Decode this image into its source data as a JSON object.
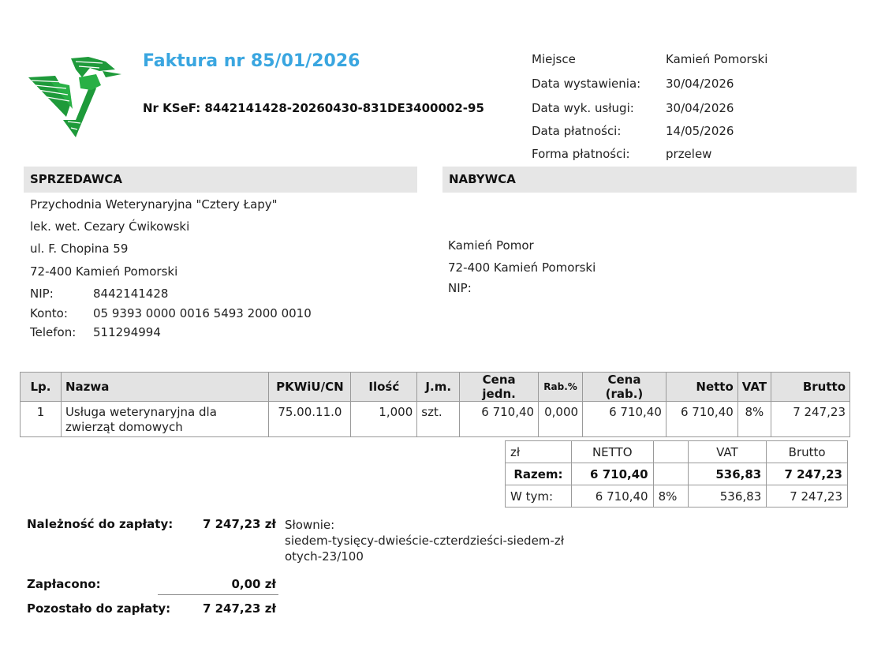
{
  "header": {
    "title": "Faktura nr 85/01/2026",
    "ksef": "Nr KSeF: 8442141428-20260430-831DE3400002-95"
  },
  "meta": [
    {
      "label": "Miejsce",
      "value": "Kamień Pomorski"
    },
    {
      "label": "Data wystawienia:",
      "value": "30/04/2026"
    },
    {
      "label": "Data wyk. usługi:",
      "value": "30/04/2026"
    },
    {
      "label": "Data płatności:",
      "value": "14/05/2026"
    },
    {
      "label": "Forma płatności:",
      "value": "przelew"
    }
  ],
  "seller": {
    "heading": "SPRZEDAWCA",
    "name": "Przychodnia Weterynaryjna \"Cztery Łapy\"",
    "person": "lek. wet. Cezary Ćwikowski",
    "street": "ul. F. Chopina 59",
    "city": "72-400 Kamień Pomorski",
    "nip_label": "NIP:",
    "nip": "8442141428",
    "account_label": "Konto:",
    "account": "05 9393 0000 0016 5493 2000 0010",
    "phone_label": "Telefon:",
    "phone": "511294994"
  },
  "buyer": {
    "heading": "NABYWCA",
    "line1": "Kamień Pomor",
    "city": "72-400 Kamień Pomorski",
    "nip_label": "NIP:"
  },
  "items_table": {
    "headers": {
      "lp": "Lp.",
      "nazwa": "Nazwa",
      "pkwiu": "PKWiU/CN",
      "ilosc": "Ilość",
      "jm": "J.m.",
      "cena": "Cena jedn.",
      "rab": "Rab.%",
      "cena_rab": "Cena (rab.)",
      "netto": "Netto",
      "vat": "VAT",
      "brutto": "Brutto"
    },
    "rows": [
      {
        "lp": "1",
        "nazwa": "Usługa weterynaryjna dla zwierząt domowych",
        "pkwiu": "75.00.11.0",
        "ilosc": "1,000",
        "jm": "szt.",
        "cena": "6 710,40",
        "rab": "0,000",
        "cena_rab": "6 710,40",
        "netto": "6 710,40",
        "vat": "8%",
        "brutto": "7 247,23"
      }
    ]
  },
  "summary": {
    "headers": {
      "currency": "zł",
      "netto": "NETTO",
      "vat": "VAT",
      "brutto": "Brutto"
    },
    "total": {
      "label": "Razem:",
      "netto": "6 710,40",
      "vat": "536,83",
      "brutto": "7 247,23"
    },
    "breakdown": {
      "label": "W tym:",
      "netto": "6 710,40",
      "rate": "8%",
      "vat": "536,83",
      "brutto": "7 247,23"
    }
  },
  "payment": {
    "due_label": "Należność do zapłaty:",
    "due_value": "7 247,23 zł",
    "words_label": "Słownie:",
    "words_line1": "siedem-tysięcy-dwieście-czterdzieści-siedem-zł",
    "words_line2": "otych-23/100",
    "paid_label": "Zapłacono:",
    "paid_value": "0,00 zł",
    "remaining_label": "Pozostało do zapłaty:",
    "remaining_value": "7 247,23 zł"
  }
}
